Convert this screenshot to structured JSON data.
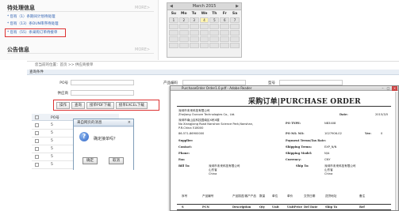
{
  "todo": {
    "title": "待处理信息",
    "more": "MORE>",
    "items": [
      "* 您有（1）条期间计划待处理",
      "* 您有（13）条DUN审序待处理",
      "* 您有（55）条采购订单待接单"
    ]
  },
  "notice": {
    "title": "公告信息",
    "more": "MORE>"
  },
  "calendar": {
    "month": "March 2015",
    "prev": "◀",
    "next": "▶",
    "dow": [
      "Su",
      "Mo",
      "Tu",
      "We",
      "Th",
      "Fr",
      "Sa"
    ],
    "first_row": [
      "1",
      "2",
      "3",
      "4",
      "5",
      "6",
      "7"
    ],
    "today": "4"
  },
  "page": {
    "breadcrumb": "您当前的位置：首页 >> 供应商接单",
    "section": "查询条件",
    "fields": {
      "po_label": "PO号",
      "supplier_label": "供应商",
      "product_label": "产品编码",
      "model_label": "型号"
    },
    "buttons": [
      "操作",
      "查询",
      "接单PDF下载",
      "接单EXCEL下载"
    ],
    "grid": {
      "header": "PO号",
      "rows": [
        "5",
        "5",
        "5",
        "5",
        "5",
        "5"
      ]
    },
    "colors": {
      "highlight": "#d33333"
    }
  },
  "dialog": {
    "title": "来自网页的消息",
    "close": "×",
    "icon": "question-icon",
    "message": "确定接单吗？",
    "ok": "确定",
    "cancel": "取消"
  },
  "pdf": {
    "window_title": "PurchaseOrder Order1.0.pdf - Adobe Reader",
    "heading": "采购订单|PURCHASE ORDER",
    "company_lines": [
      "深圳市未来科技有限公司",
      "Zhejiang Ourcore Technologies Co., Ltd.",
      "深圳市南山区科技园南区X栋X楼",
      "No Xiangjiang Road Nanshan Science Park,Nanshan,",
      "P.R.China 518000",
      "86-571-86900000"
    ],
    "date_label": "Date:",
    "date_value": "2015/3/5",
    "po_type_label": "PO TYPE:",
    "po_type_value": "NB3408",
    "po_no_label": "PO NO. NO:",
    "po_no_value": "1027906-02",
    "ver_label": "Ver:",
    "ver_value": "0",
    "left_labels": [
      "Supplier:",
      "Contact:",
      "Phone:",
      "Fax:",
      "Bill To:"
    ],
    "right_labels": [
      "Payment Terms/Tax Rate:",
      "Shipping Terms:",
      "Shipping Model:",
      "Currency:",
      "Ship To:"
    ],
    "right_values": [
      "",
      "EXP_N/N",
      "N/A",
      "CNY",
      ""
    ],
    "bill_to_lines": [
      "深圳市未来科技有限公司",
      "山东省",
      "China"
    ],
    "ship_to_lines": [
      "深圳市未来科技有限公司",
      "山东省",
      "China"
    ],
    "table_header": [
      "序号",
      "产品编号",
      "产品描述/客户产品",
      "数量",
      "单位",
      "单价",
      "交货日期",
      "送货地址",
      "备注"
    ],
    "table_header_en": [
      "S",
      "PCN",
      "Description",
      "Qty",
      "Unit",
      "UnitPrice",
      "Del Date",
      "Ship To",
      "Ref"
    ]
  }
}
